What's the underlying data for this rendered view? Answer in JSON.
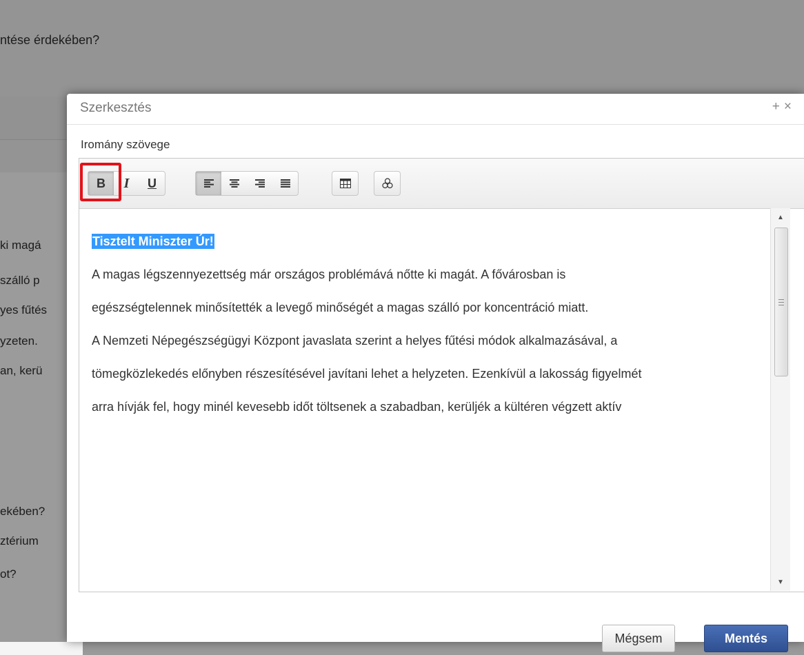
{
  "background": {
    "question_top": "ntése érdekében?",
    "lines": [
      "ki magá",
      "szálló p",
      "yes fűtés",
      "yzeten.",
      "an, kerü",
      "ekében?",
      "ztérium",
      "ot?"
    ]
  },
  "modal": {
    "title": "Szerkesztés",
    "maximize": "+",
    "close": "×",
    "field_label": "Iromány szövege"
  },
  "toolbar": {
    "bold": "B",
    "italic": "I",
    "underline": "U"
  },
  "content": {
    "paragraphs": [
      "Tisztelt Miniszter Úr!",
      "A magas légszennyezettség már országos problémává nőtte ki magát. A fővárosban is",
      "egészségtelennek minősítették a levegő minőségét a magas szálló por koncentráció miatt.",
      "A Nemzeti Népegészségügyi Központ javaslata szerint a helyes fűtési módok alkalmazásával, a",
      "tömegközlekedés előnyben részesítésével javítani lehet a helyzeten. Ezenkívül a lakosság figyelmét",
      "arra hívják fel, hogy minél kevesebb időt töltsenek a szabadban, kerüljék a kültéren végzett aktív"
    ]
  },
  "buttons": {
    "cancel": "Mégsem",
    "save": "Mentés"
  },
  "colors": {
    "accent_save": "#2f4f91",
    "selection": "#3399ff",
    "highlight_box": "#e3121a"
  }
}
